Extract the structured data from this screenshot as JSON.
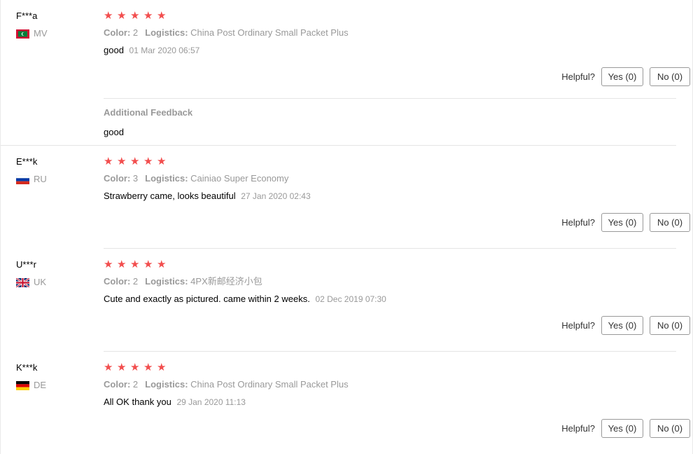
{
  "labels": {
    "color": "Color:",
    "logistics": "Logistics:",
    "helpful": "Helpful?",
    "additional_feedback": "Additional Feedback"
  },
  "colors": {
    "star": "#f24e4e",
    "muted": "#999999",
    "text": "#000000"
  },
  "reviews": [
    {
      "user": "F***a",
      "country": "MV",
      "flag_icon": "maldives-flag-icon",
      "rating": 5,
      "color_value": "2",
      "logistics_value": "China Post Ordinary Small Packet Plus",
      "text": "good",
      "date": "01 Mar 2020 06:57",
      "yes": "Yes (0)",
      "no": "No (0)",
      "additional_feedback": "good"
    },
    {
      "user": "E***k",
      "country": "RU",
      "flag_icon": "russia-flag-icon",
      "rating": 5,
      "color_value": "3",
      "logistics_value": "Cainiao Super Economy",
      "text": "Strawberry came, looks beautiful",
      "date": "27 Jan 2020 02:43",
      "yes": "Yes (0)",
      "no": "No (0)"
    },
    {
      "user": "U***r",
      "country": "UK",
      "flag_icon": "uk-flag-icon",
      "rating": 5,
      "color_value": "2",
      "logistics_value": "4PX新邮经济小包",
      "text": "Cute and exactly as pictured. came within 2 weeks.",
      "date": "02 Dec 2019 07:30",
      "yes": "Yes (0)",
      "no": "No (0)"
    },
    {
      "user": "K***k",
      "country": "DE",
      "flag_icon": "germany-flag-icon",
      "rating": 5,
      "color_value": "2",
      "logistics_value": "China Post Ordinary Small Packet Plus",
      "text": "All OK thank you",
      "date": "29 Jan 2020 11:13",
      "yes": "Yes (0)",
      "no": "No (0)"
    }
  ]
}
